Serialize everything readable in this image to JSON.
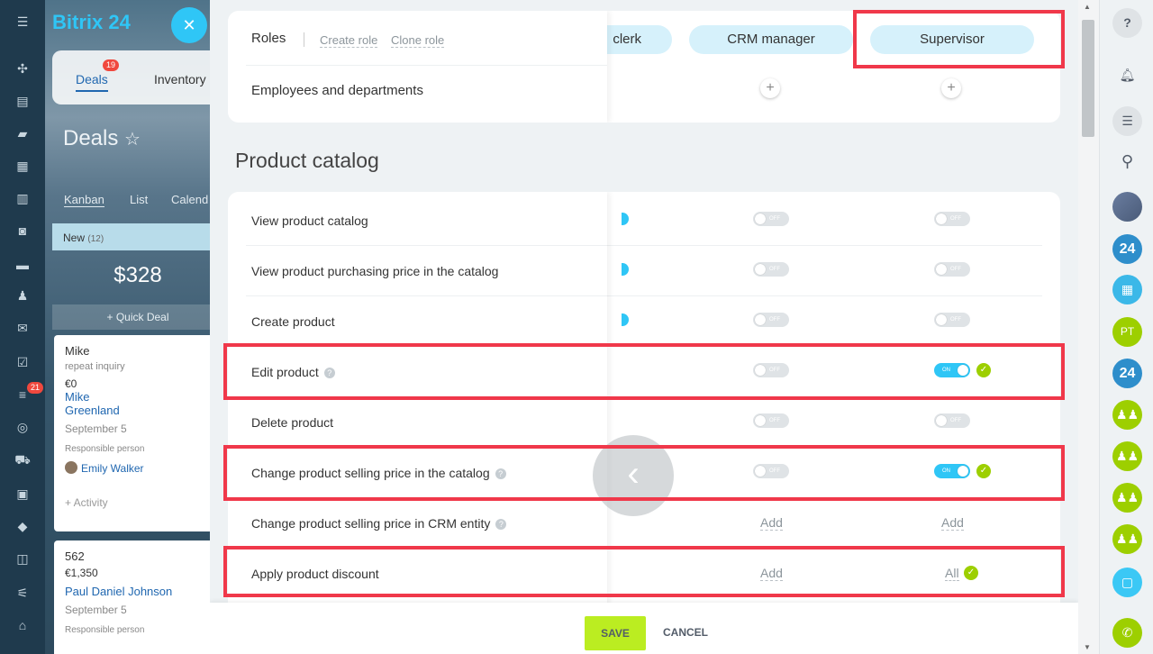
{
  "app": {
    "logo_main": "Bitrix",
    "logo_accent": "24",
    "close_glyph": "✕"
  },
  "bg": {
    "tabs": [
      {
        "label": "Deals",
        "badge": "19"
      },
      {
        "label": "Inventory"
      }
    ],
    "title": "Deals",
    "star": "☆",
    "views": [
      "Kanban",
      "List",
      "Calend"
    ],
    "column": {
      "name": "New",
      "count": "(12)"
    },
    "sum": "$328",
    "quick_deal": "+ Quick Deal",
    "cards": [
      {
        "title": "Mike",
        "subtitle": "repeat inquiry",
        "amount": "€0",
        "contact_line1": "Mike",
        "contact_line2": "Greenland",
        "date": "September 5",
        "responsible_label": "Responsible person",
        "responsible": "Emily Walker",
        "activity": "+ Activity"
      },
      {
        "title": "562",
        "amount": "€1,350",
        "contact_line1": "Paul Daniel Johnson",
        "date": "September 5",
        "responsible_label": "Responsible person"
      }
    ]
  },
  "left_bar": {
    "badge": "21"
  },
  "roles": {
    "title": "Roles",
    "create_link": "Create role",
    "clone_link": "Clone role",
    "columns": [
      "clerk",
      "CRM manager",
      "Supervisor"
    ],
    "employees_row": "Employees and departments",
    "plus": "+"
  },
  "section": {
    "title": "Product catalog",
    "toggle_off": "OFF",
    "toggle_on": "ON",
    "help": "?",
    "check": "✓",
    "rows": [
      {
        "label": "View product catalog"
      },
      {
        "label": "View product purchasing price in the catalog"
      },
      {
        "label": "Create product"
      },
      {
        "label": "Edit product"
      },
      {
        "label": "Delete product"
      },
      {
        "label": "Change product selling price in the catalog"
      },
      {
        "label": "Change product selling price in CRM entity",
        "crm_value": "Add",
        "supervisor_value": "Add"
      },
      {
        "label": "Apply product discount",
        "crm_value": "Add",
        "supervisor_value": "All"
      }
    ]
  },
  "nav": {
    "back": "‹"
  },
  "footer": {
    "save": "SAVE",
    "cancel": "CANCEL"
  },
  "right_bar": {
    "help": "?",
    "badge_24": "24",
    "avatar_initials": "PT"
  }
}
